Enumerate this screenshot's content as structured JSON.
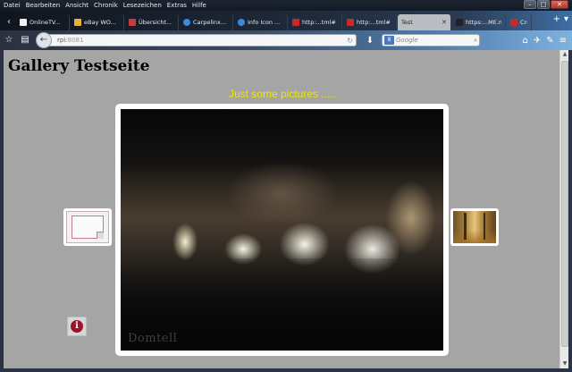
{
  "menu": [
    "Datei",
    "Bearbeiten",
    "Ansicht",
    "Chronik",
    "Lesezeichen",
    "Extras",
    "Hilfe"
  ],
  "tabs": [
    {
      "label": "OnlineTV...",
      "color": "#f0f0f0"
    },
    {
      "label": "eBay WO...",
      "color": "#e5b53a"
    },
    {
      "label": "Übersicht...",
      "color": "#c43c3c"
    },
    {
      "label": "Carpelinx...",
      "color": "#3a8ad8"
    },
    {
      "label": "Info Icon ...",
      "color": "#3a8ad8"
    },
    {
      "label": "http:...tml#",
      "color": "#c62b2b"
    },
    {
      "label": "http:...tml#",
      "color": "#c62b2b"
    },
    {
      "label": "Test",
      "color": "#ffffff",
      "active": true
    },
    {
      "label": "https:...ME.md",
      "color": "#222222"
    },
    {
      "label": "Cre...",
      "color": "#c62b2b"
    }
  ],
  "url": {
    "host": "rpi",
    "port": ":8081"
  },
  "search": {
    "placeholder": "Google"
  },
  "page": {
    "title": "Gallery Testseite",
    "subtitle": "Just some pictures .....",
    "watermark": "Domtell"
  },
  "info_symbol": "i",
  "colors": {
    "background": "#a5a5a5",
    "subtitle": "#f2e400",
    "info": "#9b1428"
  }
}
